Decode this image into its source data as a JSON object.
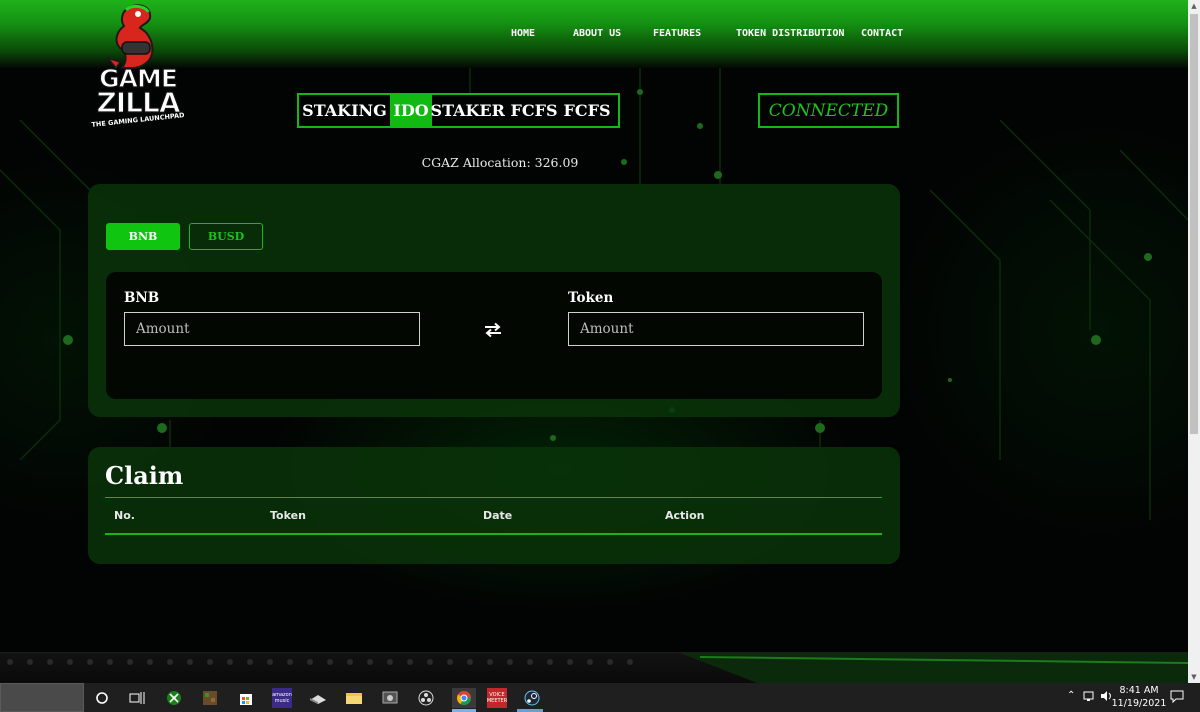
{
  "logo": {
    "line1": "GAME",
    "line2": "ZILLA",
    "tagline": "THE GAMING LAUNCHPAD"
  },
  "nav": [
    {
      "label": "HOME"
    },
    {
      "label": "ABOUT US"
    },
    {
      "label": "FEATURES"
    },
    {
      "label": "TOKEN DISTRIBUTION"
    },
    {
      "label": "CONTACT"
    }
  ],
  "tabs": [
    {
      "label": "STAKING",
      "active": false
    },
    {
      "label": "IDO",
      "active": true
    },
    {
      "label": "STAKER FCFS",
      "active": false
    },
    {
      "label": "FCFS",
      "active": false
    }
  ],
  "wallet": {
    "status": "CONNECTED"
  },
  "allocation": {
    "text": "CGAZ Allocation: 326.09"
  },
  "ido": {
    "currencies": [
      {
        "label": "BNB",
        "selected": true
      },
      {
        "label": "BUSD",
        "selected": false
      }
    ],
    "from": {
      "label": "BNB",
      "placeholder": "Amount",
      "value": ""
    },
    "to": {
      "label": "Token",
      "placeholder": "Amount",
      "value": ""
    },
    "swap_icon": "swap-arrows-icon"
  },
  "claim": {
    "title": "Claim",
    "columns": [
      "No.",
      "Token",
      "Date",
      "Action"
    ],
    "rows": []
  },
  "colors": {
    "accent": "#12b912",
    "panel": "#093409",
    "connected_text": "#1ec41e"
  },
  "taskbar": {
    "icons": [
      "cortana-circle-icon",
      "task-view-icon",
      "xbox-icon",
      "minecraft-icon",
      "microsoft-store-icon",
      "amazon-music-icon",
      "drive-icon",
      "file-explorer-icon",
      "screenshot-tool-icon",
      "obs-icon",
      "chrome-icon",
      "voicemeeter-icon",
      "steam-icon"
    ],
    "amazon_music_label": "amazon music",
    "voicemeeter_label": "VOICE MEETER",
    "time": "8:41 AM",
    "date": "11/19/2021"
  }
}
